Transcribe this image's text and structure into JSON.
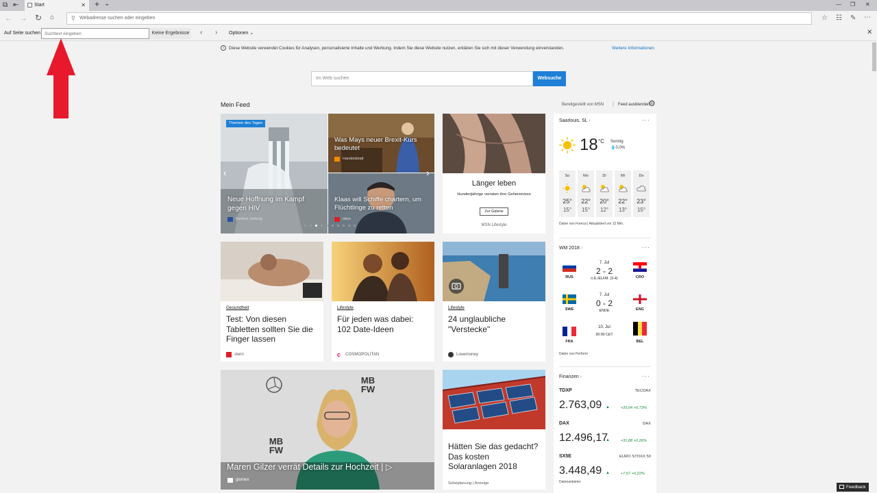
{
  "browser": {
    "tab_title": "Start",
    "new_tab": "+",
    "tab_menu": "⌄",
    "window_min": "—",
    "window_max": "❐",
    "window_close": "✕",
    "address_placeholder": "Webadresse suchen oder eingeben",
    "icons": [
      "back-icon",
      "forward-icon",
      "refresh-icon",
      "home-icon",
      "star-icon",
      "favorites-icon",
      "pen-icon",
      "share-icon",
      "more-icon"
    ]
  },
  "findbar": {
    "label": "Auf Seite suchen",
    "placeholder": "Suchtext eingeben",
    "results": "Keine Ergebnisse",
    "options": "Optionen"
  },
  "page": {
    "cookie_text": "Diese Website verwendet Cookies für Analysen, personalisierte Inhalte und Werbung. Indem Sie diese Website nutzen, erklären Sie sich mit dieser Verwendung einverstanden.",
    "cookie_link": "Weitere Informationen",
    "search_placeholder": "Im Web suchen",
    "search_button": "Websuche",
    "feed_title": "Mein Feed",
    "provided_by": "Bereitgestellt von MSN",
    "hide_feed": "Feed ausblenden",
    "feedback": "Feedback"
  },
  "carousel": {
    "badge": "Themen des Tages",
    "main_title": "Neue Hoffnung im Kampf gegen HIV",
    "main_source": "Berliner Zeitung",
    "top_title": "Was Mays neuer Brexit-Kurs bedeutet",
    "top_source": "Handelsblatt",
    "bottom_title": "Klaas will Schiffe chartern, um Flüchtlinge zu retten",
    "bottom_source": "stern",
    "slide_count": 11,
    "active_slide": 3
  },
  "gallery": {
    "title": "Länger leben",
    "subtitle": "Hundertjährige verraten ihre Geheimnisse",
    "button": "Zur Galerie",
    "source": "MSN Lifestyle"
  },
  "articles": [
    {
      "category": "Gesundheit",
      "title": "Test: Von diesen Tabletten sollten Sie die Finger lassen",
      "source": "stern"
    },
    {
      "category": "Lifestyle",
      "title": "Für jeden was dabei: 102 Date-Ideen",
      "source": "COSMOPOLITAN"
    },
    {
      "category": "Lifestyle",
      "title": "24 unglaubliche \"Verstecke\"",
      "source": "Lovemoney"
    }
  ],
  "big_story": {
    "title": "Maren Gilzer verrät Details zur Hochzeit |",
    "source": "glomex",
    "backdrop_text": [
      "MB",
      "FW"
    ]
  },
  "solar": {
    "title": "Hätten Sie das gedacht? Das kosten Solaranlagen 2018",
    "source": "Solarplanung | Anzeige"
  },
  "weather": {
    "location": "Saarlouis, SL",
    "temp": "18",
    "unit": "°C",
    "condition": "Sonnig",
    "precip": "0,0%",
    "days": [
      {
        "day": "So",
        "hi": "25°",
        "lo": "15°",
        "icon": "sun-icon"
      },
      {
        "day": "Mo",
        "hi": "22°",
        "lo": "15°",
        "icon": "partly-cloudy-icon"
      },
      {
        "day": "Di",
        "hi": "20°",
        "lo": "12°",
        "icon": "partly-cloudy-icon"
      },
      {
        "day": "Mi",
        "hi": "22°",
        "lo": "13°",
        "icon": "partly-cloudy-icon"
      },
      {
        "day": "Do",
        "hi": "23°",
        "lo": "15°",
        "icon": "cloud-icon"
      }
    ],
    "note": "Daten von Foreca | Aktualisiert vor 12 Min."
  },
  "wm": {
    "title": "WM 2018",
    "matches": [
      {
        "home": "RUS",
        "away": "CRO",
        "date": "7. Jul",
        "score": "2 - 2",
        "status": "n.E./ELFM. (3-4)"
      },
      {
        "home": "SWE",
        "away": "ENG",
        "date": "7. Jul",
        "score": "0 - 2",
        "status": "ENDE"
      },
      {
        "home": "FRA",
        "away": "BEL",
        "date": "10. Jul",
        "score": "",
        "status": "20:00 CET"
      }
    ],
    "note": "Daten von Perform"
  },
  "finance": {
    "title": "Finanzen",
    "items": [
      {
        "symbol": "TDXP",
        "exchange": "TECDAX",
        "value": "2.763,09",
        "change": "+20,04 +0,73%"
      },
      {
        "symbol": "DAX",
        "exchange": "DAX",
        "value": "12.496,17",
        "change": "+31,88 +0,26%"
      },
      {
        "symbol": "SX5E",
        "exchange": "EURO STOXX 50",
        "value": "3.448,49",
        "change": "+7,57 +0,22%"
      }
    ],
    "note": "Datenanbieter"
  },
  "annotation": {
    "arrow_color": "#e8192c"
  },
  "colors": {
    "accent": "#1e7fd6",
    "positive": "#1a8a3a"
  }
}
